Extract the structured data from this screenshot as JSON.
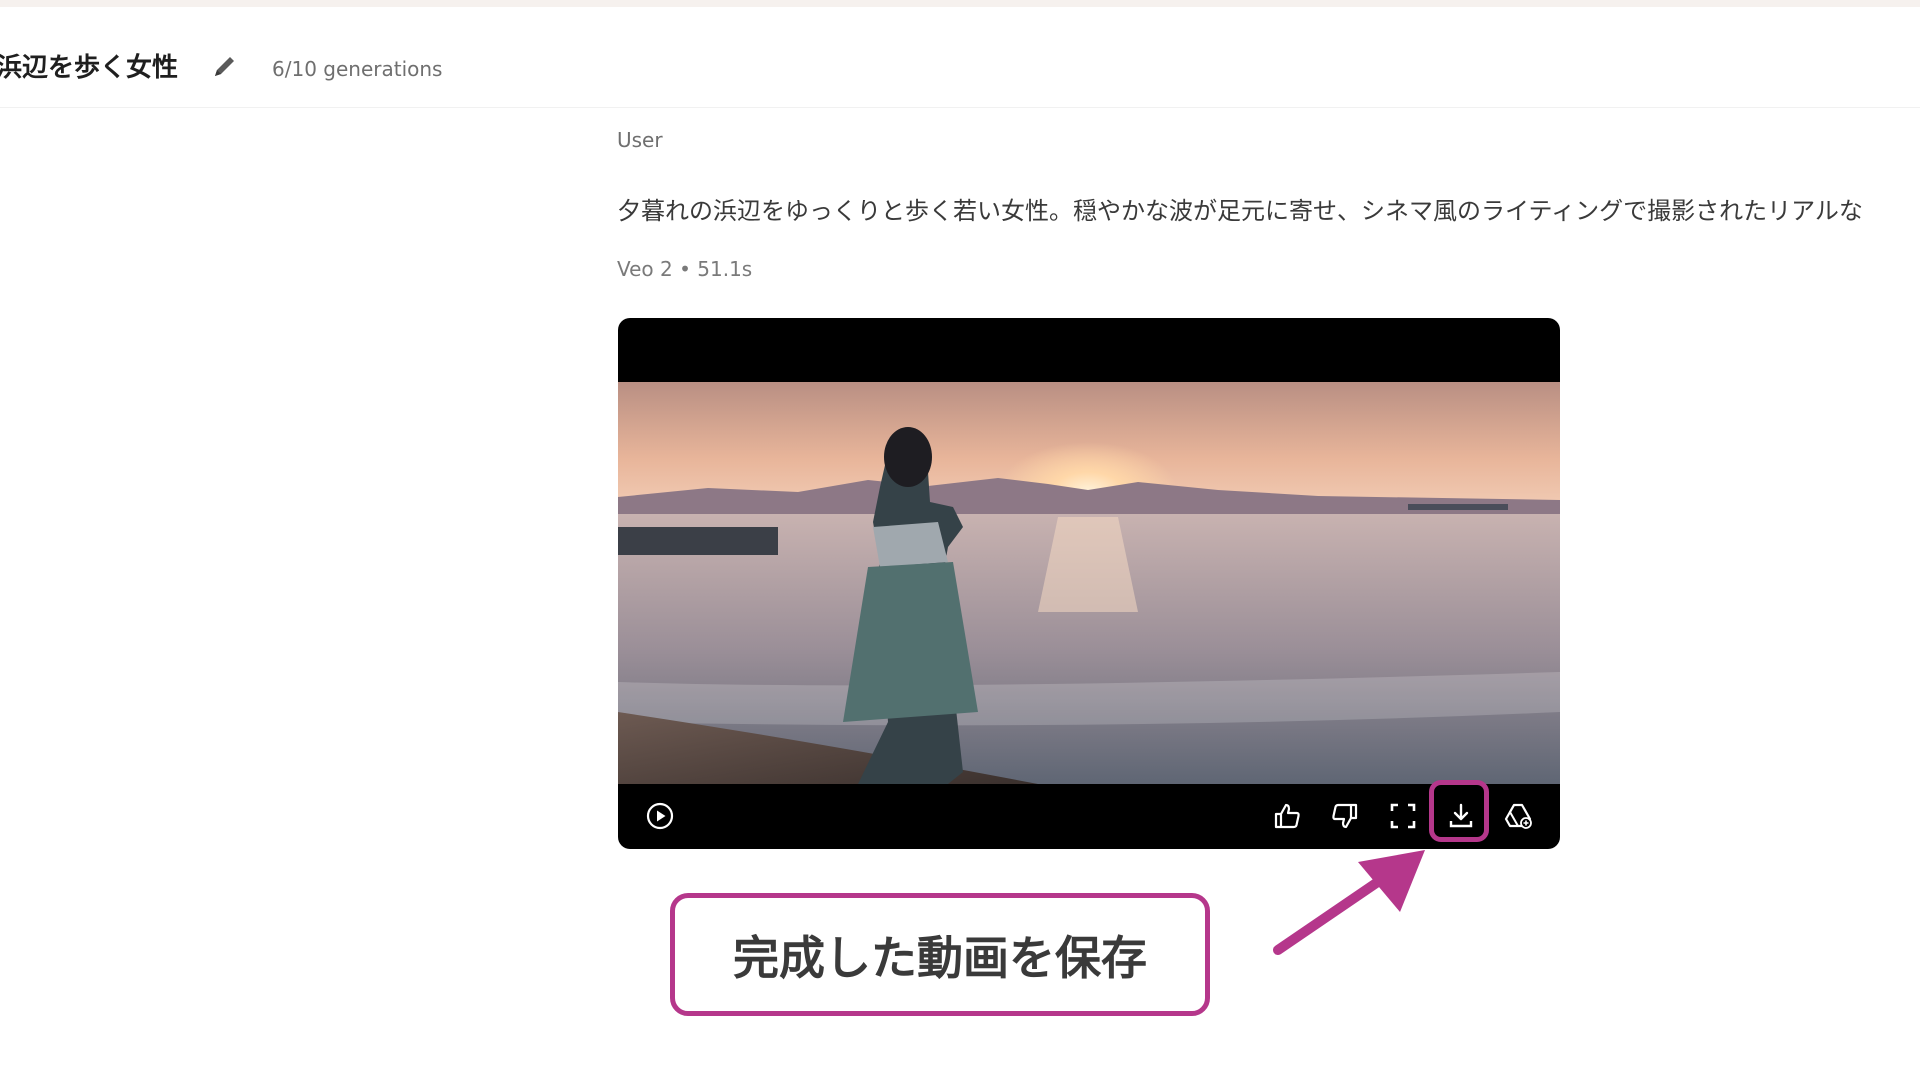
{
  "header": {
    "title": "浜辺を歩く女性",
    "generations": "6/10 generations"
  },
  "message": {
    "author": "User",
    "prompt": "夕暮れの浜辺をゆっくりと歩く若い女性。穏やかな波が足元に寄せ、シネマ風のライティングで撮影されたリアルな",
    "meta": "Veo 2 • 51.1s"
  },
  "video": {
    "controls": [
      "play-icon",
      "thumbs-up-icon",
      "thumbs-down-icon",
      "fullscreen-icon",
      "download-icon",
      "drive-save-icon"
    ]
  },
  "annotation": {
    "callout_text": "完成した動画を保存",
    "accent_color": "#b5378b"
  }
}
